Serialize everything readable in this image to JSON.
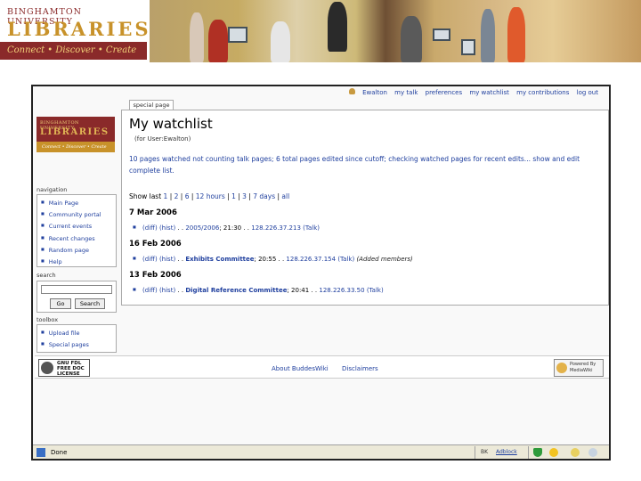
{
  "banner": {
    "logo_top": "BINGHAMTON UNIVERSITY",
    "logo_main": "LIBRARIES",
    "logo_tagline": "Connect • Discover • Create"
  },
  "personal_tools": {
    "items": [
      "Ewalton",
      "my talk",
      "preferences",
      "my watchlist",
      "my contributions",
      "log out"
    ]
  },
  "sidebar": {
    "logo_top": "BINGHAMTON UNIVERSITY",
    "logo_main": "LIBRARIES",
    "logo_tagline": "Connect • Discover • Create",
    "navigation_title": "navigation",
    "navigation": [
      "Main Page",
      "Community portal",
      "Current events",
      "Recent changes",
      "Random page",
      "Help"
    ],
    "search_title": "search",
    "go_label": "Go",
    "search_label": "Search",
    "toolbox_title": "toolbox",
    "toolbox": [
      "Upload file",
      "Special pages"
    ]
  },
  "content": {
    "tab_label": "special page",
    "title": "My watchlist",
    "subtitle": "(for User:Ewalton)",
    "info_text": "10 pages watched not counting talk pages; 6 total pages edited since cutoff; ",
    "info_link1": "checking watched pages for recent edits...",
    "info_link2": "show and edit complete list.",
    "show_last_prefix": "Show last",
    "show_last_options": [
      "1",
      "2",
      "6",
      "12 hours",
      "1",
      "3",
      "7 days",
      "all"
    ],
    "entries": [
      {
        "date": "7 Mar 2006",
        "diff": "(diff)",
        "hist": "(hist)",
        "dots": ". .",
        "page": "2005/2006",
        "time": "; 21:30",
        "ip": "128.226.37.213",
        "talk": "(Talk)",
        "comment": ""
      },
      {
        "date": "16 Feb 2006",
        "diff": "(diff)",
        "hist": "(hist)",
        "dots": ". .",
        "page": "Exhibits Committee",
        "time": "; 20:55",
        "ip": "128.226.37.154",
        "talk": "(Talk)",
        "comment": "(Added members)"
      },
      {
        "date": "13 Feb 2006",
        "diff": "(diff)",
        "hist": "(hist)",
        "dots": ". .",
        "page": "Digital Reference Committee",
        "time": "; 20:41",
        "ip": "128.226.33.50",
        "talk": "(Talk)",
        "comment": ""
      }
    ]
  },
  "footer": {
    "gnu_text": "GNU FDL FREE DOC LICENSE",
    "about_link": "About BuddesWiki",
    "disclaimers_link": "Disclaimers",
    "mediawiki_text": "Powered By MediaWiki"
  },
  "statusbar": {
    "status": "Done",
    "zone1": "BK",
    "zone2": "Adblock"
  },
  "colors": {
    "link": "#1f3f9e",
    "brand_maroon": "#8a2a2a",
    "brand_gold": "#c8922a"
  }
}
